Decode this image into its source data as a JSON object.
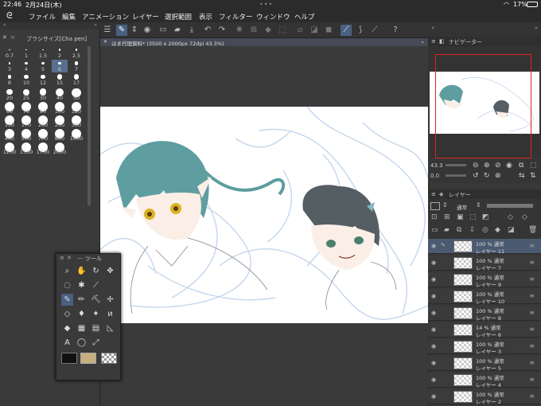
{
  "status": {
    "time": "22:46",
    "date": "2月24日(木)",
    "battery": "17%"
  },
  "menu": [
    "ファイル",
    "編集",
    "アニメーション",
    "レイヤー",
    "選択範囲",
    "表示",
    "フィルター",
    "ウィンドウ",
    "ヘルプ"
  ],
  "brush_panel": {
    "title": "ブラシサイズ[Cha pen]",
    "sizes": [
      "0.7",
      "1",
      "1.5",
      "2",
      "2.5",
      "3",
      "4",
      "5",
      "6",
      "7",
      "8",
      "10",
      "12",
      "15",
      "17",
      "20",
      "25",
      "30",
      "40",
      "50",
      "60",
      "70",
      "80",
      "100",
      "120",
      "150",
      "170",
      "200",
      "250",
      "300",
      "400",
      "500",
      "700",
      "800",
      "1000",
      "1200",
      "1500",
      "1700",
      "2000"
    ],
    "selected": "6"
  },
  "document": {
    "tab": "ほま代理資料* (3500 x 2000px 72dpi 43.3%)"
  },
  "tool_palette": {
    "title": "ツール"
  },
  "navigator": {
    "title": "ナビゲーター",
    "zoom": "43.3",
    "rotation": "0.0"
  },
  "layer_panel": {
    "title": "レイヤー",
    "blend": "通常",
    "layers": [
      {
        "opacity": "100 % 通常",
        "name": "レイヤー 11",
        "selected": true
      },
      {
        "opacity": "100 % 通常",
        "name": "レイヤー 7"
      },
      {
        "opacity": "100 % 通常",
        "name": "レイヤー 9"
      },
      {
        "opacity": "100 % 通常",
        "name": "レイヤー 10"
      },
      {
        "opacity": "100 % 通常",
        "name": "レイヤー 8"
      },
      {
        "opacity": "14 % 通常",
        "name": "レイヤー 6"
      },
      {
        "opacity": "100 % 通常",
        "name": "レイヤー 3"
      },
      {
        "opacity": "100 % 通常",
        "name": "レイヤー 5"
      },
      {
        "opacity": "100 % 通常",
        "name": "レイヤー 4"
      },
      {
        "opacity": "100 % 通常",
        "name": "レイヤー 2"
      }
    ]
  },
  "colors": {
    "main": "#111111",
    "sub": "#c8ad7f",
    "accent": "#5a6f8f"
  }
}
